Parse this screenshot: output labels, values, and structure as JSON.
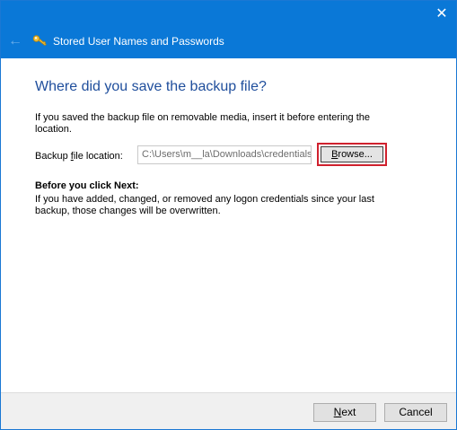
{
  "window": {
    "title": "Stored User Names and Passwords",
    "back_glyph": "←",
    "close_glyph": "✕",
    "accent_color": "#0a78d7"
  },
  "content": {
    "heading": "Where did you save the backup file?",
    "intro": "If you saved the backup file on removable media, insert it before entering the location.",
    "location_label": {
      "pre": "Backup ",
      "accel": "f",
      "post": "ile location:"
    },
    "location_value": "C:\\Users\\m__la\\Downloads\\credentials",
    "browse_button": {
      "accel": "B",
      "post": "rowse..."
    },
    "before_title": "Before you click Next:",
    "before_text": "If you have added, changed, or removed any logon credentials since your last backup, those changes will be overwritten."
  },
  "footer": {
    "next_button": {
      "accel": "N",
      "post": "ext"
    },
    "cancel_button": "Cancel"
  },
  "highlight_color": "#d0212e",
  "icons": {
    "back": "back-arrow-icon",
    "title": "key-icon",
    "close": "close-icon"
  }
}
